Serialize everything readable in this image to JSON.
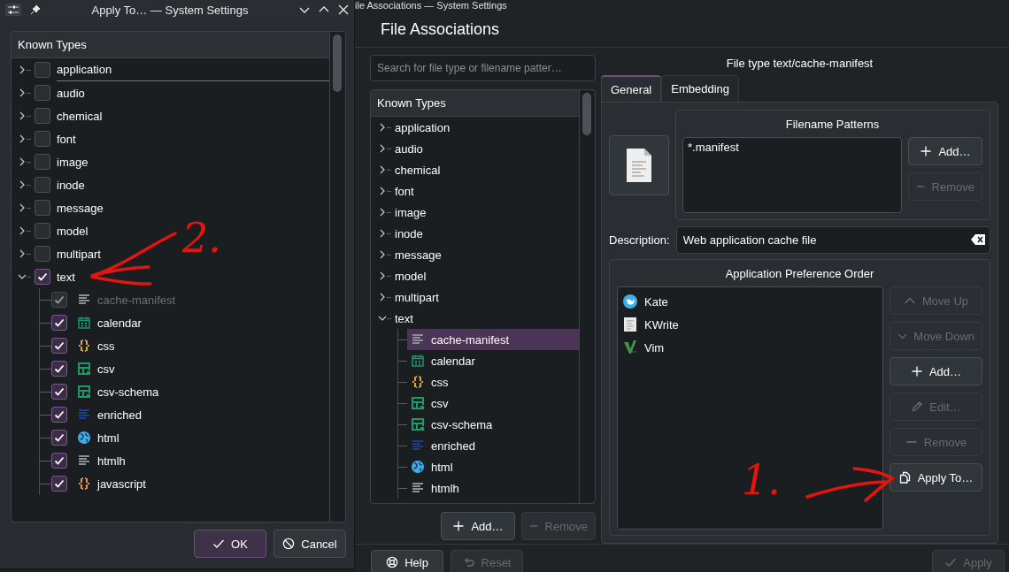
{
  "dialog": {
    "title": "Apply To… — System Settings",
    "tree": {
      "header": "Known Types",
      "items": [
        {
          "label": "application",
          "expanded": false,
          "checked": false,
          "focused": true
        },
        {
          "label": "audio",
          "expanded": false,
          "checked": false,
          "focused": false
        },
        {
          "label": "chemical",
          "expanded": false,
          "checked": false,
          "focused": false
        },
        {
          "label": "font",
          "expanded": false,
          "checked": false,
          "focused": false
        },
        {
          "label": "image",
          "expanded": false,
          "checked": false,
          "focused": false
        },
        {
          "label": "inode",
          "expanded": false,
          "checked": false,
          "focused": false
        },
        {
          "label": "message",
          "expanded": false,
          "checked": false,
          "focused": false
        },
        {
          "label": "model",
          "expanded": false,
          "checked": false,
          "focused": false
        },
        {
          "label": "multipart",
          "expanded": false,
          "checked": false,
          "focused": false
        },
        {
          "label": "text",
          "expanded": true,
          "checked": true,
          "focused": false,
          "children": [
            {
              "label": "cache-manifest",
              "kind": "lines",
              "color": "#8b9096",
              "checked": true,
              "disabled": true
            },
            {
              "label": "calendar",
              "kind": "calendar",
              "color": "#1d9a6c",
              "checked": true,
              "disabled": false
            },
            {
              "label": "css",
              "kind": "braces",
              "color": "#d9a62e",
              "checked": true,
              "disabled": false
            },
            {
              "label": "csv",
              "kind": "table",
              "color": "#1d9a6c",
              "checked": true,
              "disabled": false
            },
            {
              "label": "csv-schema",
              "kind": "table",
              "color": "#1d9a6c",
              "checked": true,
              "disabled": false
            },
            {
              "label": "enriched",
              "kind": "lines",
              "color": "#1f3c88",
              "checked": true,
              "disabled": false
            },
            {
              "label": "html",
              "kind": "globe",
              "color": "#3daee9",
              "checked": true,
              "disabled": false
            },
            {
              "label": "htmlh",
              "kind": "lines",
              "color": "#8b9096",
              "checked": true,
              "disabled": false
            },
            {
              "label": "javascript",
              "kind": "braces",
              "color": "#e8914a",
              "checked": true,
              "disabled": false
            }
          ]
        }
      ]
    },
    "buttons": [
      {
        "label": "OK",
        "kind": "check",
        "default": true
      },
      {
        "label": "Cancel",
        "kind": "cancel",
        "default": false
      }
    ]
  },
  "main": {
    "title": "ile Associations — System Settings",
    "heading": "File Associations",
    "search": {
      "placeholder": "Search for file type or filename patter…"
    },
    "tree": {
      "header": "Known Types",
      "items": [
        {
          "label": "application",
          "expanded": false,
          "selected": false
        },
        {
          "label": "audio",
          "expanded": false,
          "selected": false
        },
        {
          "label": "chemical",
          "expanded": false,
          "selected": false
        },
        {
          "label": "font",
          "expanded": false,
          "selected": false
        },
        {
          "label": "image",
          "expanded": false,
          "selected": false
        },
        {
          "label": "inode",
          "expanded": false,
          "selected": false
        },
        {
          "label": "message",
          "expanded": false,
          "selected": false
        },
        {
          "label": "model",
          "expanded": false,
          "selected": false
        },
        {
          "label": "multipart",
          "expanded": false,
          "selected": false
        },
        {
          "label": "text",
          "expanded": true,
          "selected": false,
          "children": [
            {
              "label": "cache-manifest",
              "kind": "lines",
              "color": "#8b9096",
              "selected": true
            },
            {
              "label": "calendar",
              "kind": "calendar",
              "color": "#1d9a6c",
              "selected": false
            },
            {
              "label": "css",
              "kind": "braces",
              "color": "#d9a62e",
              "selected": false
            },
            {
              "label": "csv",
              "kind": "table",
              "color": "#1d9a6c",
              "selected": false
            },
            {
              "label": "csv-schema",
              "kind": "table",
              "color": "#1d9a6c",
              "selected": false
            },
            {
              "label": "enriched",
              "kind": "lines",
              "color": "#1f3c88",
              "selected": false
            },
            {
              "label": "html",
              "kind": "globe",
              "color": "#3daee9",
              "selected": false
            },
            {
              "label": "htmlh",
              "kind": "lines",
              "color": "#8b9096",
              "selected": false
            }
          ]
        }
      ]
    },
    "tree_buttons": [
      {
        "label": "Add…",
        "kind": "plus",
        "disabled": false
      },
      {
        "label": "Remove",
        "kind": "minus",
        "disabled": true
      }
    ],
    "type_title": "File type text/cache-manifest",
    "tabs": [
      {
        "label": "General",
        "selected": true
      },
      {
        "label": "Embedding",
        "selected": false
      }
    ],
    "patterns": {
      "title": "Filename Patterns",
      "items": [
        "*.manifest"
      ],
      "buttons": [
        {
          "label": "Add…",
          "kind": "plus",
          "disabled": false
        },
        {
          "label": "Remove",
          "kind": "minus",
          "disabled": true
        }
      ]
    },
    "description": {
      "label": "Description:",
      "value": "Web application cache file"
    },
    "apps": {
      "title": "Application Preference Order",
      "items": [
        {
          "name": "Kate",
          "kind": "round"
        },
        {
          "name": "KWrite",
          "kind": "page"
        },
        {
          "name": "Vim",
          "kind": "vmark"
        }
      ],
      "buttons": [
        {
          "label": "Move Up",
          "kind": "up",
          "disabled": true
        },
        {
          "label": "Move Down",
          "kind": "down",
          "disabled": true
        },
        {
          "label": "Add…",
          "kind": "plus",
          "disabled": false
        },
        {
          "label": "Edit…",
          "kind": "pencil",
          "disabled": true
        },
        {
          "label": "Remove",
          "kind": "minus",
          "disabled": true
        },
        {
          "label": "Apply To…",
          "kind": "copy",
          "disabled": false
        }
      ]
    },
    "footer_buttons": [
      {
        "label": "Help",
        "kind": "help",
        "disabled": false
      },
      {
        "label": "Reset",
        "kind": "reset",
        "disabled": true
      },
      {
        "label": "Apply",
        "kind": "check",
        "disabled": true
      }
    ]
  },
  "annotations": [
    {
      "label": "1."
    },
    {
      "label": "2."
    }
  ]
}
